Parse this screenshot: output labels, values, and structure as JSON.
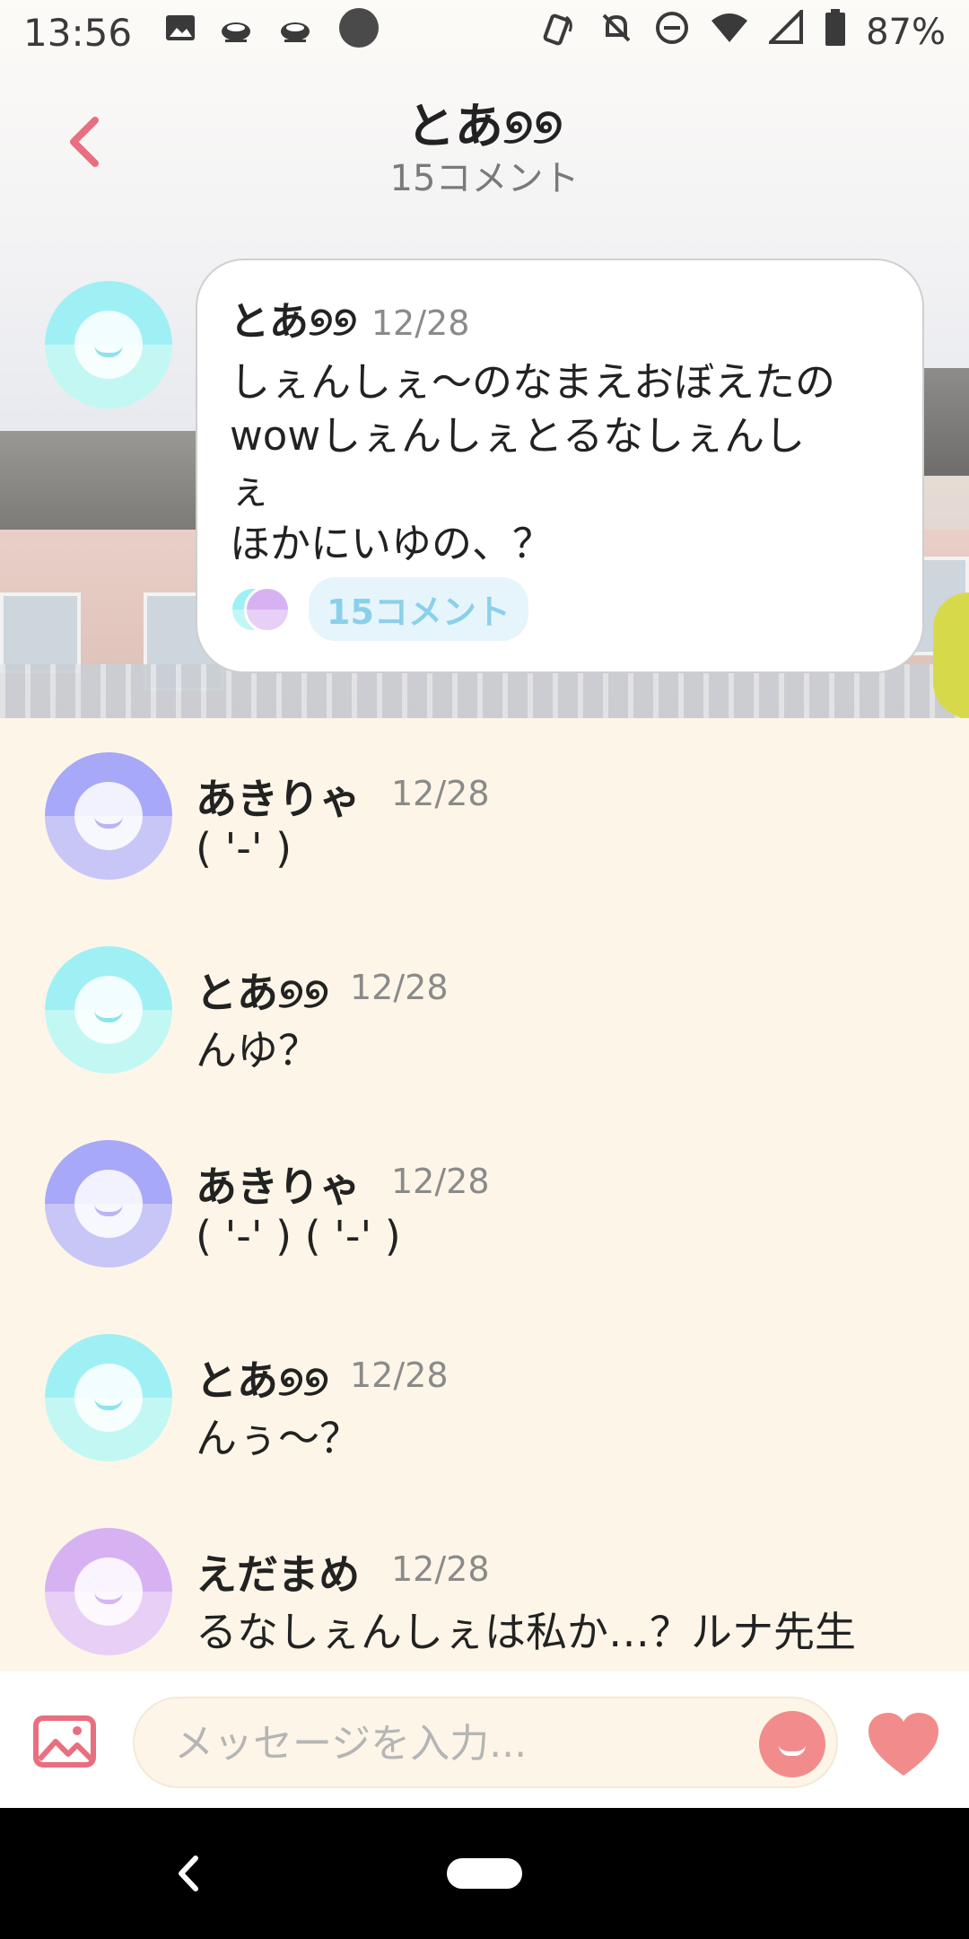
{
  "status_bar": {
    "time": "13:56",
    "battery": "87%",
    "icons": [
      "image-icon",
      "cup-icon",
      "cup-icon",
      "dot-icon",
      "nfc-icon",
      "bell-off-icon",
      "dnd-icon",
      "wifi-icon",
      "signal-icon",
      "battery-icon"
    ]
  },
  "header": {
    "title": "とあ୭୭",
    "subtitle": "15コメント"
  },
  "post": {
    "name": "とあ୭୭",
    "date": "12/28",
    "text": "しぇんしぇ〜のなまえおぼえたの\nwowしぇんしぇとるなしぇんし\nぇ\nほかにいゆの、？",
    "comments_pill": "15コメント"
  },
  "comments": [
    {
      "name": "あきりゃ",
      "date": "12/28",
      "text": "( '-' )",
      "color": "blue"
    },
    {
      "name": "とあ୭୭",
      "date": "12/28",
      "text": "んゆ？",
      "color": "cyan"
    },
    {
      "name": "あきりゃ",
      "date": "12/28",
      "text": "( '-' ) ( '-' )",
      "color": "blue"
    },
    {
      "name": "とあ୭୭",
      "date": "12/28",
      "text": "んぅ〜？",
      "color": "cyan"
    },
    {
      "name": "えだまめ",
      "date": "12/28",
      "text": "るなしぇんしぇは私か…？ルナ先生",
      "color": "purple"
    }
  ],
  "input": {
    "placeholder": "メッセージを入力..."
  },
  "colors": {
    "accent": "#f28c8c",
    "background": "#fdf6e8",
    "pill_text": "#8bd0ea"
  }
}
